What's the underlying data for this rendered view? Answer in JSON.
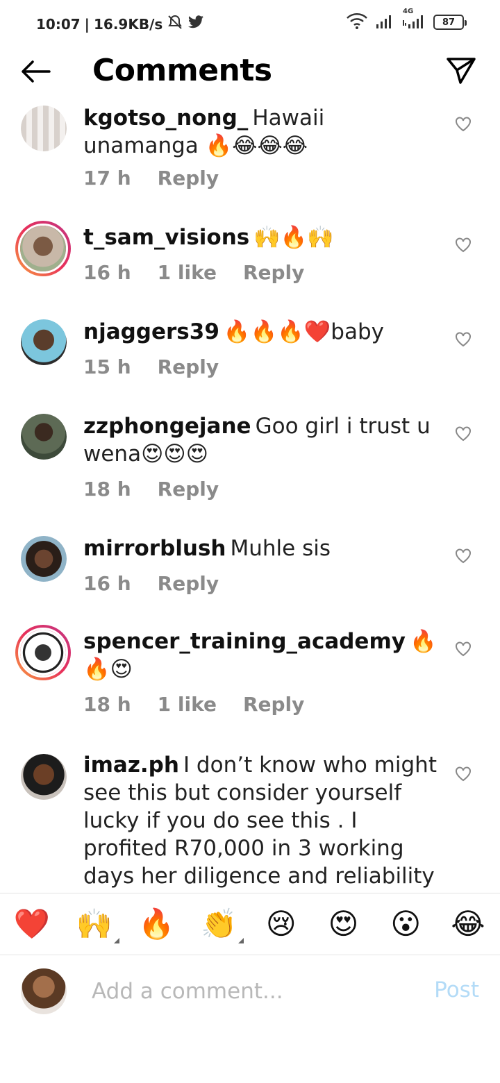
{
  "status_bar": {
    "time": "10:07",
    "speed": "16.9KB/s",
    "network_label": "4G",
    "battery": "87",
    "icons": [
      "bell-off-icon",
      "twitter-icon",
      "wifi-icon",
      "signal-icon",
      "signal-4g-icon",
      "battery-icon"
    ]
  },
  "header": {
    "title": "Comments",
    "back_icon": "arrow-left-icon",
    "share_icon": "paper-plane-icon"
  },
  "comments": [
    {
      "username": "kgotso_nong_",
      "text": "Hawaii unamanga 🔥😂😂😂",
      "time": "17 h",
      "likes": "",
      "reply": "Reply"
    },
    {
      "username": "t_sam_visions",
      "text": "🙌🔥🙌",
      "time": "16 h",
      "likes": "1 like",
      "reply": "Reply"
    },
    {
      "username": "njaggers39",
      "text": "🔥🔥🔥❤️baby",
      "time": "15 h",
      "likes": "",
      "reply": "Reply"
    },
    {
      "username": "zzphongejane",
      "text": "Goo girl i trust u wena😍😍😍",
      "time": "18 h",
      "likes": "",
      "reply": "Reply"
    },
    {
      "username": "mirrorblush",
      "text": "Muhle sis",
      "time": "16 h",
      "likes": "",
      "reply": "Reply"
    },
    {
      "username": "spencer_training_academy",
      "text": "🔥🔥😍",
      "time": "18 h",
      "likes": "1 like",
      "reply": "Reply"
    },
    {
      "username": "imaz.ph",
      "text": "I don’t know who might see this but consider yourself lucky if you do see this . I profited R70,000 in 3 working days her diligence and reliability can’t",
      "time": "",
      "likes": "",
      "reply": ""
    }
  ],
  "emoji_bar": [
    "❤️",
    "🙌",
    "🔥",
    "👏",
    "😢",
    "😍",
    "😮",
    "😂"
  ],
  "composer": {
    "placeholder": "Add a comment...",
    "post_label": "Post"
  },
  "colors": {
    "ring_gradient_start": "#f9a03f",
    "ring_gradient_end": "#c13584",
    "post_disabled": "#b3dbf7",
    "meta_gray": "#8a8a8a"
  }
}
